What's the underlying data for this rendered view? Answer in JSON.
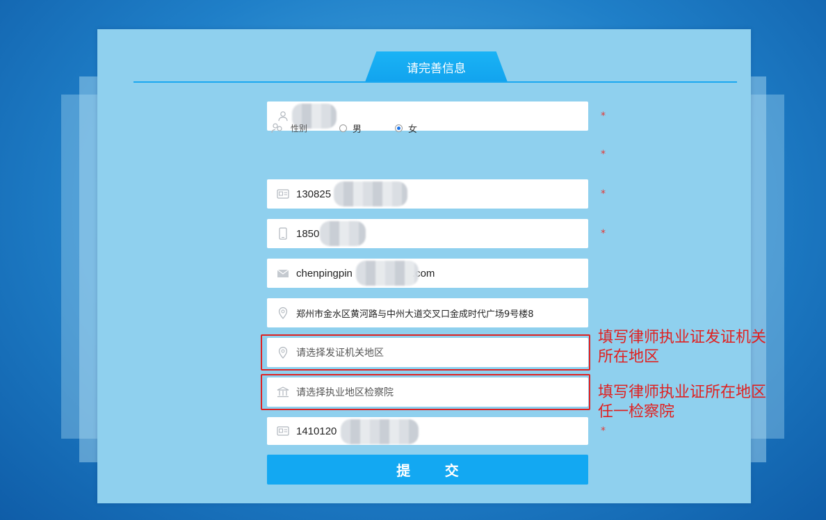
{
  "form": {
    "tab_title": "请完善信息",
    "required_mark": "*",
    "name": {
      "icon": "user-icon",
      "value": ""
    },
    "gender": {
      "icon": "gender-icon",
      "label": "性别",
      "options": [
        "男",
        "女"
      ],
      "selected": "女"
    },
    "id_number": {
      "icon": "id-card-icon",
      "value": "130825"
    },
    "phone": {
      "icon": "phone-icon",
      "value": "1850"
    },
    "email": {
      "icon": "mail-icon",
      "value_prefix": "chenpingpin",
      "value_suffix": ".com"
    },
    "address": {
      "icon": "location-icon",
      "value": "郑州市金水区黄河路与中州大道交叉口金成时代广场9号楼8"
    },
    "issuing_region": {
      "icon": "location-icon",
      "placeholder": "请选择发证机关地区"
    },
    "procuratorate": {
      "icon": "bank-icon",
      "placeholder": "请选择执业地区检察院"
    },
    "license_number": {
      "icon": "id-card-icon",
      "value": "1410120"
    },
    "submit_label": "提 交"
  },
  "annotations": {
    "issuing_region_note": [
      "填写律师执业证发证机关",
      "所在地区"
    ],
    "procuratorate_note": [
      "填写律师执业证所在地区",
      "任一检察院"
    ]
  },
  "colors": {
    "accent": "#13a8f2",
    "panel": "#8fd0ee",
    "highlight": "#e02020"
  }
}
